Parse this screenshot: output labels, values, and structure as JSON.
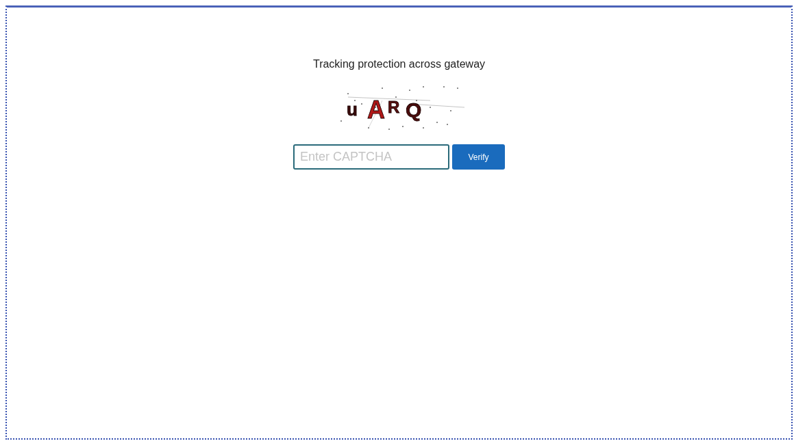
{
  "title": "Tracking protection across gateway",
  "captcha": {
    "characters": [
      "u",
      "A",
      "R",
      "Q"
    ]
  },
  "input": {
    "placeholder": "Enter CAPTCHA"
  },
  "button": {
    "label": "Verify"
  }
}
